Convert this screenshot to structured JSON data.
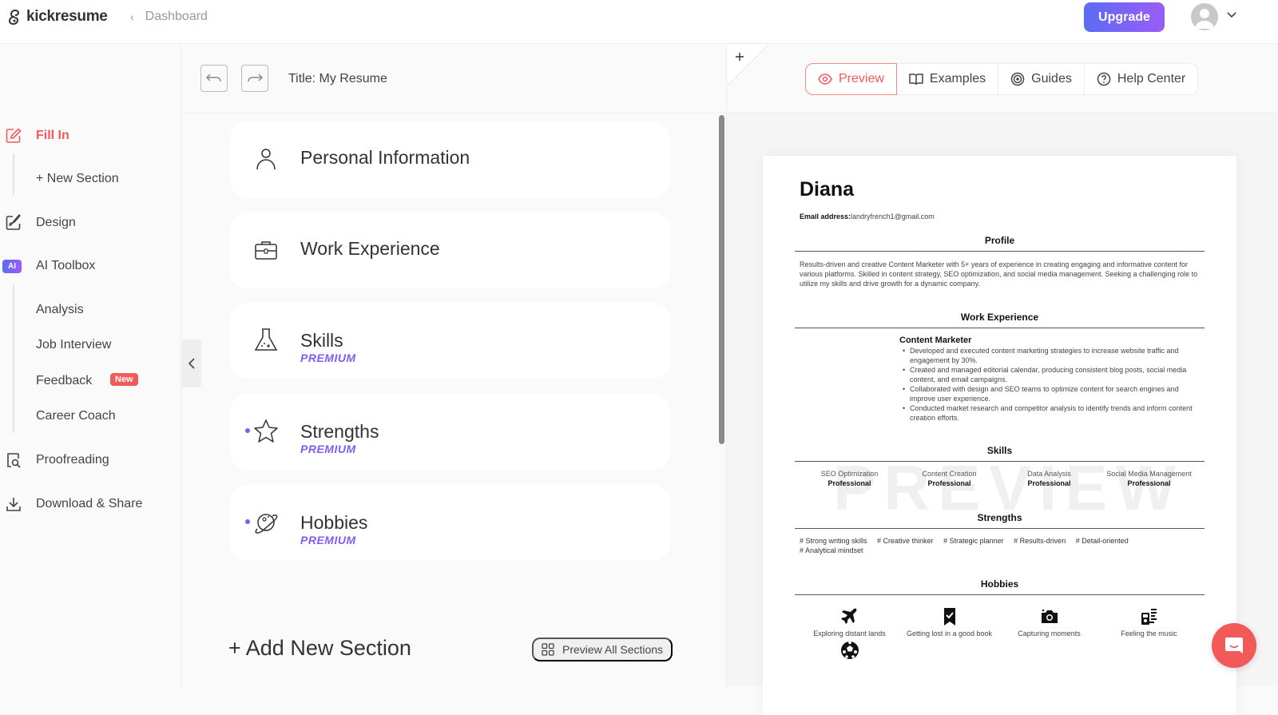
{
  "app": {
    "brand": "kickresume",
    "breadcrumb": "Dashboard",
    "upgrade_label": "Upgrade",
    "colors": {
      "accent": "#f25a5a",
      "premium": "#7f5cf6",
      "upgrade_start": "#5b6cf5",
      "upgrade_end": "#9b5cf6"
    }
  },
  "sidebar": {
    "items": [
      {
        "label": "Fill In",
        "icon": "edit-icon",
        "active": true
      },
      {
        "label": "+ New Section"
      },
      {
        "label": "Design",
        "icon": "design-brush-icon"
      },
      {
        "label": "AI Toolbox",
        "icon": "ai-badge",
        "badge": "AI"
      },
      {
        "label": "Analysis"
      },
      {
        "label": "Job Interview"
      },
      {
        "label": "Feedback",
        "badge": "New"
      },
      {
        "label": "Career Coach"
      },
      {
        "label": "Proofreading",
        "icon": "proofreading-icon"
      },
      {
        "label": "Download & Share",
        "icon": "download-icon"
      }
    ]
  },
  "editor": {
    "title": "Title: My Resume",
    "sections": [
      {
        "title": "Personal Information",
        "icon": "person-icon",
        "premium": ""
      },
      {
        "title": "Work Experience",
        "icon": "briefcase-icon",
        "premium": ""
      },
      {
        "title": "Skills",
        "icon": "flask-icon",
        "premium": "PREMIUM"
      },
      {
        "title": "Strengths",
        "icon": "star-icon",
        "premium": "PREMIUM"
      },
      {
        "title": "Hobbies",
        "icon": "planet-icon",
        "premium": "PREMIUM"
      }
    ],
    "add_section_label": "+ Add New Section",
    "preview_all_label": "Preview All Sections"
  },
  "preview_tabs": [
    {
      "label": "Preview",
      "icon": "eye-icon",
      "active": true
    },
    {
      "label": "Examples",
      "icon": "book-icon"
    },
    {
      "label": "Guides",
      "icon": "target-icon"
    },
    {
      "label": "Help Center",
      "icon": "help-icon"
    }
  ],
  "resume": {
    "name": "Diana",
    "email_label": "Email address:",
    "email": "landryfrench1@gmail.com",
    "watermark": "PREVIEW",
    "profile_heading": "Profile",
    "profile_text": "Results-driven and creative Content Marketer with 5+ years of experience in creating engaging and informative content for various platforms. Skilled in content strategy, SEO optimization, and social media management. Seeking a challenging role to utilize my skills and drive growth for a dynamic company.",
    "work_heading": "Work Experience",
    "job_title": "Content Marketer",
    "bullets": [
      "Developed and executed content marketing strategies to increase website traffic and engagement by 30%.",
      "Created and managed editorial calendar, producing consistent blog posts, social media content, and email campaigns.",
      "Collaborated with design and SEO teams to optimize content for search engines and improve user experience.",
      "Conducted market research and competitor analysis to identify trends and inform content creation efforts."
    ],
    "skills_heading": "Skills",
    "skills": [
      {
        "name": "SEO Optimization",
        "level": "Professional"
      },
      {
        "name": "Content Creation",
        "level": "Professional"
      },
      {
        "name": "Data Analysis",
        "level": "Professional"
      },
      {
        "name": "Social Media Management",
        "level": "Professional"
      }
    ],
    "strengths_heading": "Strengths",
    "strengths": [
      "# Strong writing skills",
      "# Creative thinker",
      "# Strategic planner",
      "# Results-driven",
      "# Detail-oriented",
      "# Analytical mindset"
    ],
    "hobbies_heading": "Hobbies",
    "hobbies": [
      {
        "label": "Exploring distant lands",
        "icon": "plane-icon"
      },
      {
        "label": "Getting lost in a good book",
        "icon": "bookmark-check-icon"
      },
      {
        "label": "Capturing moments",
        "icon": "camera-icon"
      },
      {
        "label": "Feeling the music",
        "icon": "music-player-icon"
      },
      {
        "label": "",
        "icon": "soccer-ball-icon"
      }
    ]
  }
}
